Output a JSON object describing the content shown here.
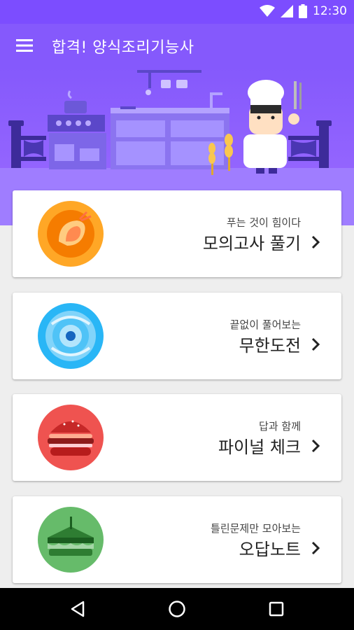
{
  "status_bar": {
    "time": "12:30"
  },
  "app_bar": {
    "title": "합격! 양식조리기능사"
  },
  "colors": {
    "primary": "#7c4dff",
    "app_bar": "#8559fc",
    "card_orange": "#ffa726",
    "card_blue": "#29b6f6",
    "card_red": "#ef5350",
    "card_green": "#66bb6a"
  },
  "menu_cards": [
    {
      "subtitle": "푸는 것이 힘이다",
      "title": "모의고사 풀기",
      "icon": "shrimp-icon"
    },
    {
      "subtitle": "끝없이 풀어보는",
      "title": "무한도전",
      "icon": "whirlpool-icon"
    },
    {
      "subtitle": "답과 함께",
      "title": "파이널 체크",
      "icon": "burger-icon"
    },
    {
      "subtitle": "틀린문제만 모아보는",
      "title": "오답노트",
      "icon": "sandwich-icon"
    }
  ]
}
